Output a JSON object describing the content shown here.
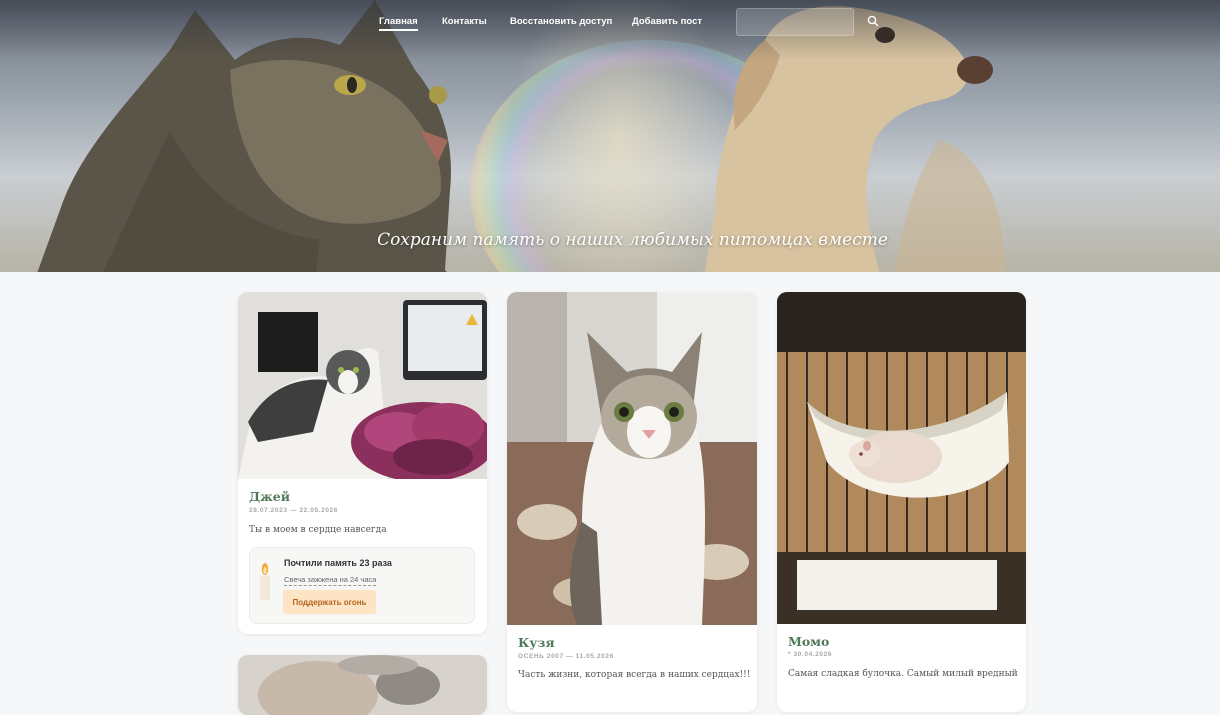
{
  "nav": {
    "items": [
      {
        "label": "Главная",
        "active": true
      },
      {
        "label": "Контакты"
      },
      {
        "label": "Восстановить доступ"
      },
      {
        "label": "Добавить пост"
      }
    ],
    "search_placeholder": ""
  },
  "hero": {
    "tagline": "Сохраним память о наших любимых питомцах вместе"
  },
  "cards": [
    {
      "name": "Джей",
      "dates": "28.07.2023 — 22.05.2026",
      "text": "Ты в моем в сердце навсегда",
      "memory": {
        "title": "Почтили память 23 раза",
        "subtitle": "Свеча зажжена на 24 часа",
        "button": "Поддержать огонь"
      }
    },
    {
      "name": "Кузя",
      "dates": "ОСЕНЬ 2007 — 11.05.2026",
      "text": "Часть жизни, которая всегда в наших сердцах!!!"
    },
    {
      "name": "Момо",
      "dates": "* 30.04.2026",
      "text": "Самая сладкая булочка. Самый милый вредный"
    }
  ],
  "colors": {
    "page_bg": "#f5f7f8",
    "name_green": "#4f7a5a",
    "button_bg": "#fde4c4",
    "button_text": "#b5651d"
  }
}
